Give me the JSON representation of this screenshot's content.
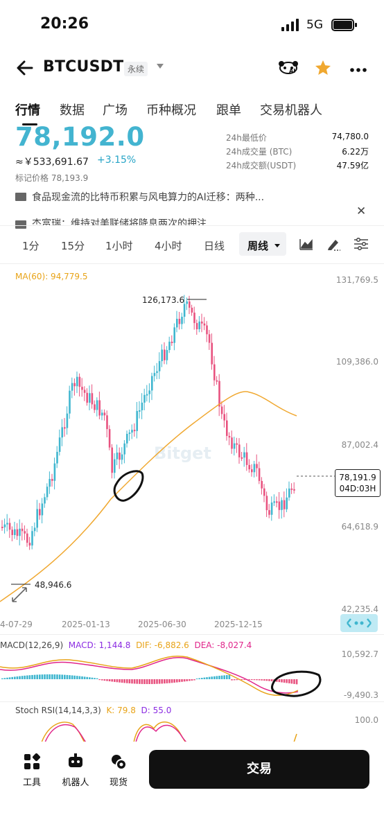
{
  "status": {
    "time": "20:26",
    "network": "5G"
  },
  "header": {
    "pair": "BTCUSDT",
    "badge": "永续",
    "icons": [
      "back-arrow-icon",
      "ai-panda-icon",
      "star-icon",
      "more-icon"
    ],
    "ai_label": "AI"
  },
  "tabs": [
    "行情",
    "数据",
    "广场",
    "币种概况",
    "跟单",
    "交易机器人"
  ],
  "price": {
    "last": "78,192.0",
    "cny": "≈￥533,691.67",
    "change": "+3.15%",
    "mark": "标记价格 78,193.9"
  },
  "stats": [
    {
      "label": "24h最低价",
      "value": "74,780.0"
    },
    {
      "label": "24h成交量 (BTC)",
      "value": "6.22万"
    },
    {
      "label": "24h成交额(USDT)",
      "value": "47.59亿"
    }
  ],
  "notices": [
    "食品现金流的比特币积累与风电算力的AI迁移：两种...",
    "杰富瑞：维持对美联储将降息两次的押注"
  ],
  "intervals": [
    "1分",
    "15分",
    "1小时",
    "4小时",
    "日线",
    "周线"
  ],
  "active_interval": "周线",
  "chart": {
    "ma_label": "MA(60): 94,779.5",
    "y_ticks": [
      "131,769.5",
      "109,386.0",
      "87,002.4",
      "64,618.9",
      "42,235.4"
    ],
    "x_ticks": [
      "4-07-29",
      "2025-01-13",
      "2025-06-30",
      "2025-12-15"
    ],
    "high_label": "126,173.6",
    "low_label": "48,946.6",
    "current_price": "78,191.9",
    "countdown": "04D:03H",
    "watermark": "Bitget"
  },
  "macd": {
    "title": "MACD(12,26,9)",
    "macd": "MACD: 1,144.8",
    "dif": "DIF: -6,882.6",
    "dea": "DEA: -8,027.4",
    "y_top": "10,592.7",
    "y_bottom": "-9,490.3"
  },
  "rsi": {
    "title": "Stoch RSI(14,14,3,3)",
    "k": "K: 79.8",
    "d": "D: 55.0",
    "y_top": "100.0"
  },
  "colors": {
    "up": "#3fb6cf",
    "down": "#e8527f",
    "ma": "#f0a830"
  },
  "bottom_bar": {
    "tools": "工具",
    "robot": "机器人",
    "spot": "现货",
    "trade": "交易"
  }
}
